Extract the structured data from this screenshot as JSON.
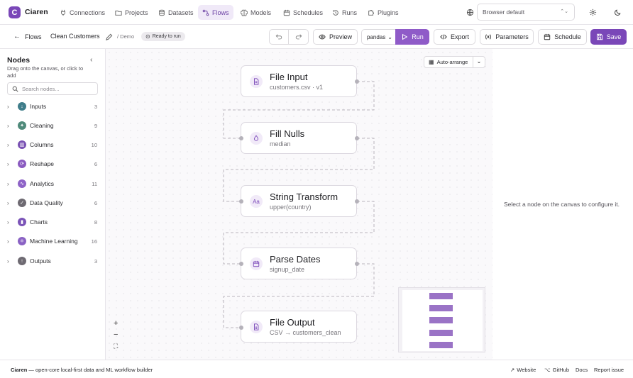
{
  "app": {
    "logo_letter": "C",
    "name": "Ciaren"
  },
  "nav": {
    "items": [
      {
        "label": "Connections",
        "icon": "plug-icon"
      },
      {
        "label": "Projects",
        "icon": "folder-icon"
      },
      {
        "label": "Datasets",
        "icon": "database-icon"
      },
      {
        "label": "Flows",
        "icon": "flow-icon",
        "active": true
      },
      {
        "label": "Models",
        "icon": "brain-icon"
      },
      {
        "label": "Schedules",
        "icon": "calendar-icon"
      },
      {
        "label": "Runs",
        "icon": "history-icon"
      },
      {
        "label": "Plugins",
        "icon": "puzzle-icon"
      }
    ],
    "browser_select": "Browser default"
  },
  "toolbar": {
    "back_label": "Flows",
    "flow_name": "Clean Customers",
    "project": "/ Demo",
    "status": "Ready to run",
    "preview": "Preview",
    "engine": "pandas",
    "run": "Run",
    "export": "Export",
    "parameters": "Parameters",
    "schedule": "Schedule",
    "save": "Save"
  },
  "sidebar": {
    "title": "Nodes",
    "subtitle": "Drag onto the canvas, or click to add",
    "search_placeholder": "Search nodes...",
    "categories": [
      {
        "label": "Inputs",
        "count": "3",
        "color": "#3f7d8a"
      },
      {
        "label": "Cleaning",
        "count": "9",
        "color": "#4f8a7a"
      },
      {
        "label": "Columns",
        "count": "10",
        "color": "#7a52b3"
      },
      {
        "label": "Reshape",
        "count": "6",
        "color": "#8a5bc0"
      },
      {
        "label": "Analytics",
        "count": "11",
        "color": "#8e63c7"
      },
      {
        "label": "Data Quality",
        "count": "6",
        "color": "#6e6a72"
      },
      {
        "label": "Charts",
        "count": "8",
        "color": "#7b54b8"
      },
      {
        "label": "Machine Learning",
        "count": "16",
        "color": "#8a62c4"
      },
      {
        "label": "Outputs",
        "count": "3",
        "color": "#6e6a72"
      }
    ]
  },
  "canvas": {
    "auto_arrange": "Auto-arrange",
    "nodes": [
      {
        "title": "File Input",
        "subtitle": "customers.csv · v1",
        "icon": "file-icon"
      },
      {
        "title": "Fill Nulls",
        "subtitle": "median",
        "icon": "droplet-icon"
      },
      {
        "title": "String Transform",
        "subtitle": "upper(country)",
        "icon": "text-case-icon"
      },
      {
        "title": "Parse Dates",
        "subtitle": "signup_date",
        "icon": "calendar-icon"
      },
      {
        "title": "File Output",
        "subtitle": "CSV → customers_clean",
        "icon": "file-download-icon"
      }
    ],
    "zoom_in": "+",
    "zoom_out": "−",
    "fit": "⛶"
  },
  "right_panel": {
    "empty_text": "Select a node on the canvas to configure it."
  },
  "footer": {
    "brand": "Ciaren",
    "tagline": " — open-core local-first data and ML workflow builder",
    "links": [
      "Website",
      "GitHub",
      "Docs",
      "Report issue"
    ]
  },
  "colors": {
    "accent": "#7a47b8",
    "accent_light": "#f0e9f8"
  }
}
